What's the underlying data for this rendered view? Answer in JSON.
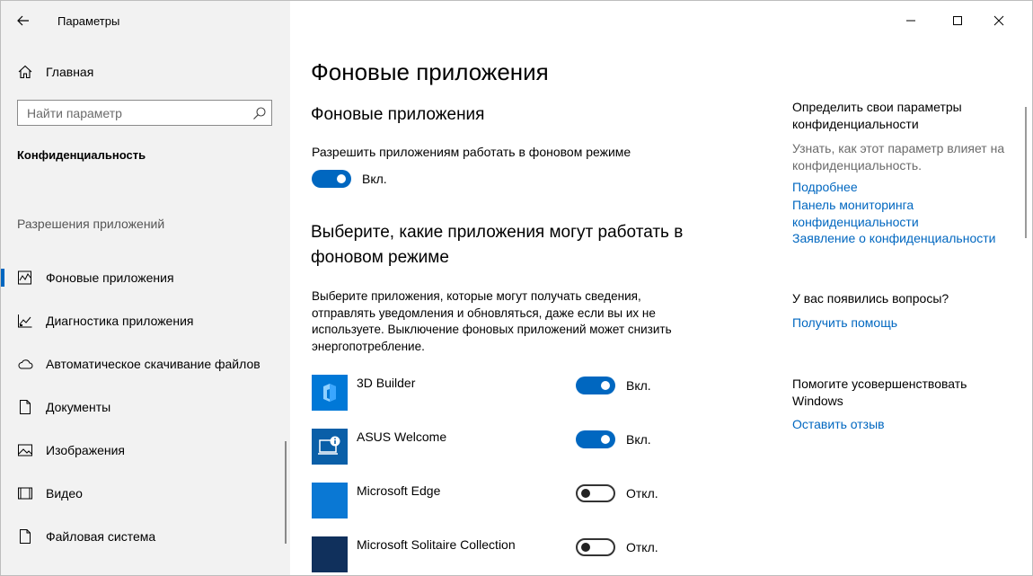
{
  "window": {
    "title": "Параметры",
    "controls": {
      "minimize": "minimize-icon",
      "maximize": "maximize-icon",
      "close": "close-icon"
    }
  },
  "sidebar": {
    "home_label": "Главная",
    "search_placeholder": "Найти параметр",
    "category": "Конфиденциальность",
    "section": "Разрешения приложений",
    "items": [
      {
        "label": "Фоновые приложения",
        "icon": "background-apps-icon",
        "active": true
      },
      {
        "label": "Диагностика приложения",
        "icon": "diagnostics-icon",
        "active": false
      },
      {
        "label": "Автоматическое скачивание файлов",
        "icon": "cloud-icon",
        "active": false
      },
      {
        "label": "Документы",
        "icon": "document-icon",
        "active": false
      },
      {
        "label": "Изображения",
        "icon": "image-icon",
        "active": false
      },
      {
        "label": "Видео",
        "icon": "video-icon",
        "active": false
      },
      {
        "label": "Файловая система",
        "icon": "file-icon",
        "active": false
      }
    ]
  },
  "main": {
    "heading": "Фоновые приложения",
    "sub_heading": "Фоновые приложения",
    "allow_label": "Разрешить приложениям работать в фоновом режиме",
    "allow_state": "Вкл.",
    "choose_heading": "Выберите, какие приложения могут работать в фоновом режиме",
    "description": "Выберите приложения, которые могут получать сведения, отправлять уведомления и обновляться, даже если вы их не используете. Выключение фоновых приложений может снизить энергопотребление.",
    "apps": [
      {
        "name": "3D Builder",
        "state": "Вкл.",
        "on": true,
        "color": "#0078d7"
      },
      {
        "name": "ASUS Welcome",
        "state": "Вкл.",
        "on": true,
        "color": "#0a5fa8"
      },
      {
        "name": "Microsoft Edge",
        "state": "Откл.",
        "on": false,
        "color": "#0a78d4"
      },
      {
        "name": "Microsoft Solitaire Collection",
        "state": "Откл.",
        "on": false,
        "color": "#10305c"
      }
    ]
  },
  "right_panel": {
    "privacy_title": "Определить свои параметры конфиденциальности",
    "privacy_text": "Узнать, как этот параметр влияет на конфиденциальность.",
    "links": [
      "Подробнее",
      "Панель мониторинга конфиденциальности",
      "Заявление о конфиденциальности"
    ],
    "questions_title": "У вас появились вопросы?",
    "help_link": "Получить помощь",
    "improve_title": "Помогите усовершенствовать Windows",
    "feedback_link": "Оставить отзыв"
  },
  "colors": {
    "accent": "#0067c0",
    "sidebar_bg": "#f2f2f2"
  }
}
